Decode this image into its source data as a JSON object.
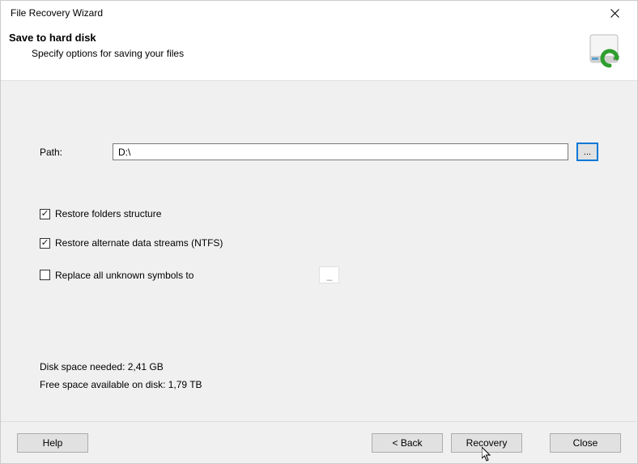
{
  "window": {
    "title": "File Recovery Wizard"
  },
  "header": {
    "heading": "Save to hard disk",
    "subtitle": "Specify options for saving your files"
  },
  "path": {
    "label": "Path:",
    "value": "D:\\",
    "browse_label": "..."
  },
  "options": {
    "restore_folders": {
      "label": "Restore folders structure",
      "checked": true
    },
    "restore_ads": {
      "label": "Restore alternate data streams (NTFS)",
      "checked": true
    },
    "replace_unknown": {
      "label": "Replace all unknown symbols to",
      "checked": false,
      "value": "_"
    }
  },
  "stats": {
    "needed_label": "Disk space needed: 2,41 GB",
    "free_label": "Free space available on disk: 1,79 TB"
  },
  "footer": {
    "help": "Help",
    "back": "< Back",
    "recovery": "Recovery",
    "close": "Close"
  }
}
